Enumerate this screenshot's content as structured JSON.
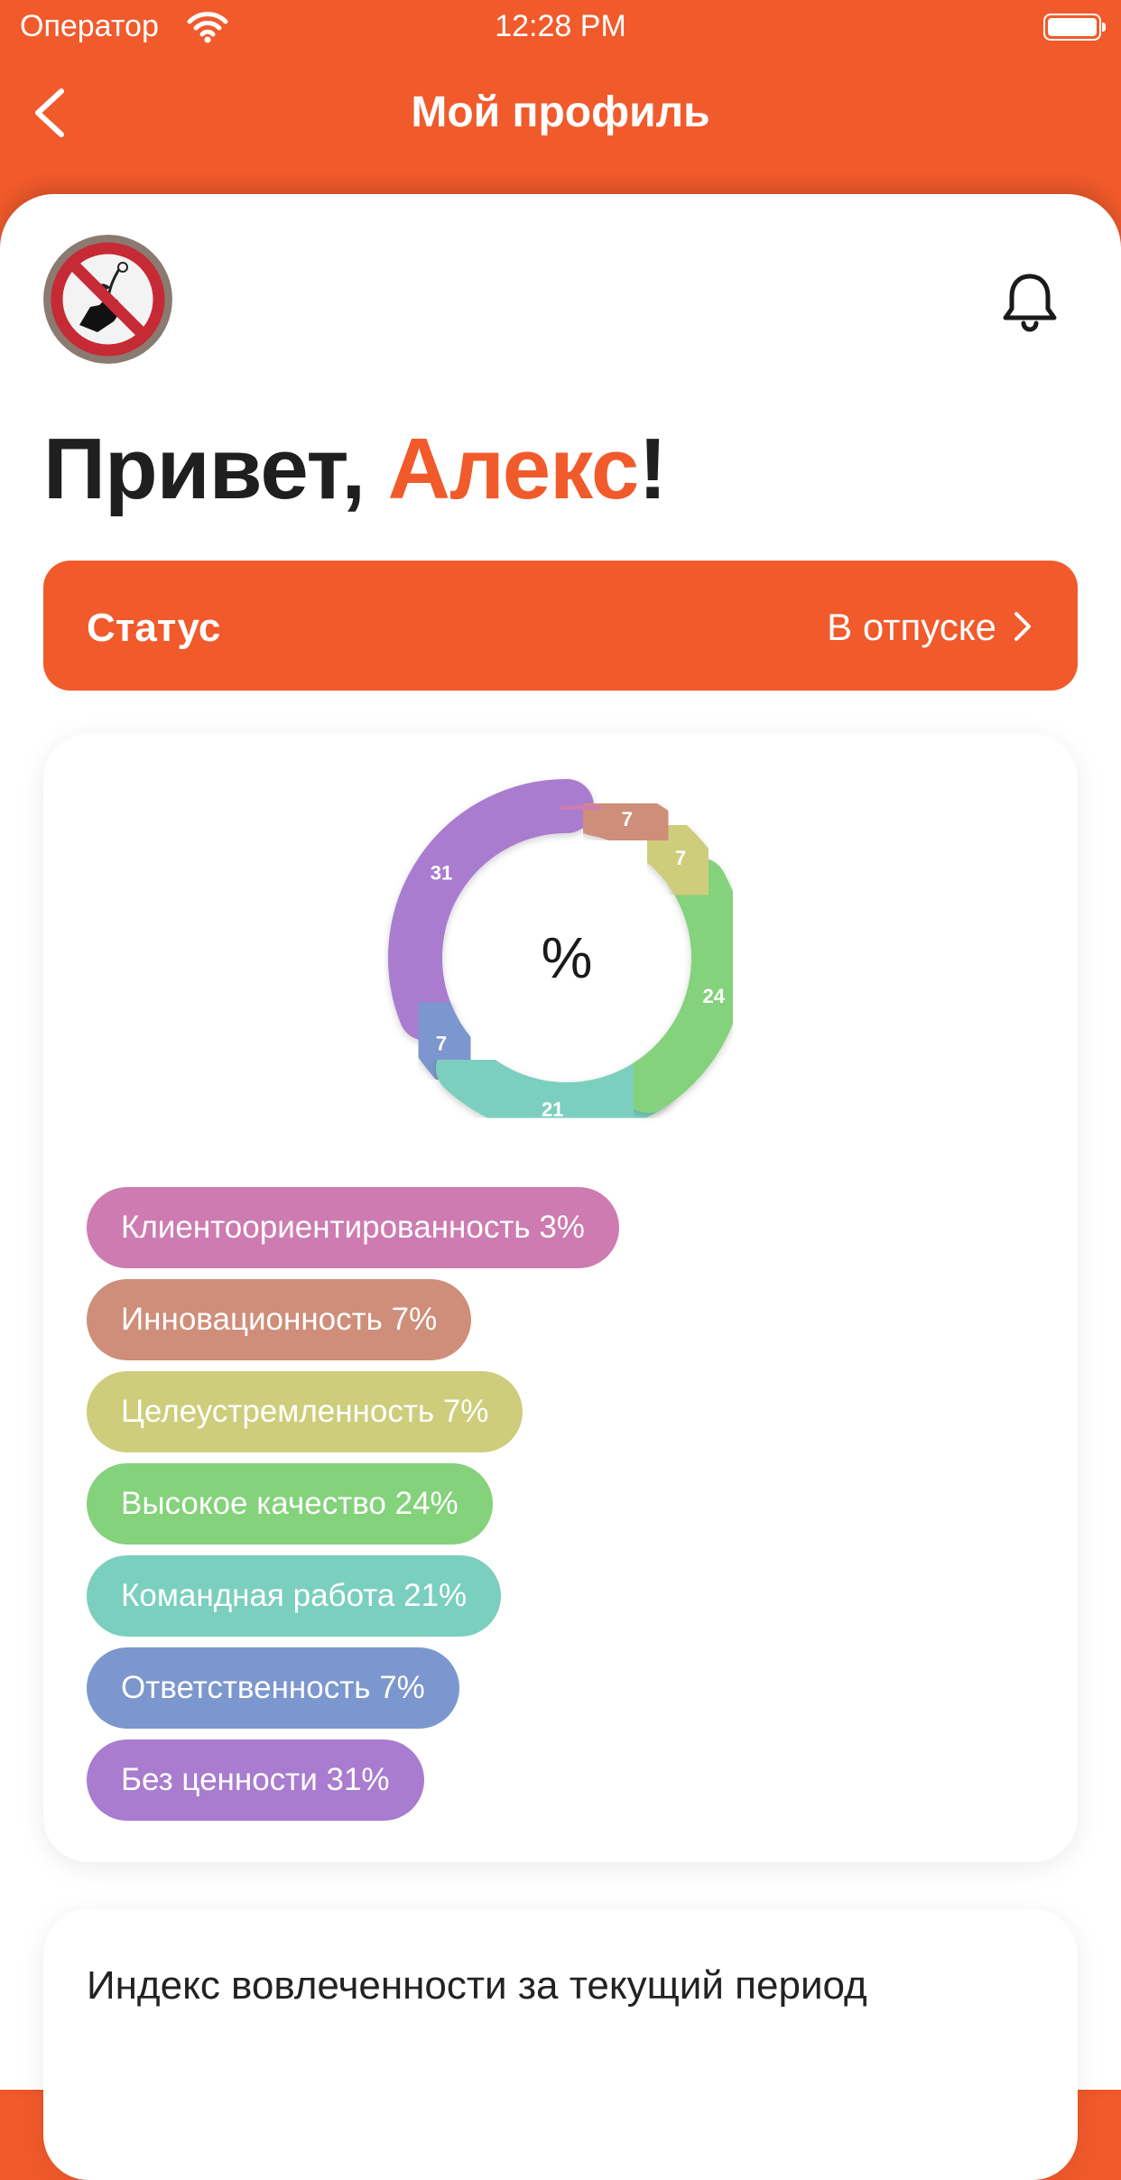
{
  "status_bar": {
    "carrier": "Оператор",
    "time": "12:28 PM"
  },
  "nav": {
    "title": "Мой профиль",
    "back_icon": "chevron-left-icon"
  },
  "header": {
    "avatar_icon": "no-picking-flowers-sign",
    "bell_icon": "bell-icon"
  },
  "greeting": {
    "prefix": "Привет, ",
    "name": "Алекс",
    "suffix": "!"
  },
  "status": {
    "label": "Статус",
    "value": "В отпуске"
  },
  "values_chart": {
    "center_label": "%",
    "legend": [
      {
        "label": "Клиентоориентированность 3%",
        "color": "#cd7bb0"
      },
      {
        "label": "Инновационность 7%",
        "color": "#cf8e79"
      },
      {
        "label": "Целеустремленность 7%",
        "color": "#cdcd7c"
      },
      {
        "label": "Высокое качество 24%",
        "color": "#84d27b"
      },
      {
        "label": "Командная работа 21%",
        "color": "#7bcfbf"
      },
      {
        "label": "Ответственность 7%",
        "color": "#7b97cd"
      },
      {
        "label": "Без ценности 31%",
        "color": "#a97ccf"
      }
    ]
  },
  "chart_data": {
    "type": "pie",
    "donut": true,
    "categories": [
      "Клиентоориентированность",
      "Инновационность",
      "Целеустремленность",
      "Высокое качество",
      "Командная работа",
      "Ответственность",
      "Без ценности"
    ],
    "values": [
      3,
      7,
      7,
      24,
      21,
      7,
      31
    ],
    "labels": [
      "",
      "7",
      "7",
      "24",
      "21",
      "7",
      "31"
    ],
    "colors": [
      "#cd7bb0",
      "#cf8e79",
      "#cdcd7c",
      "#84d27b",
      "#7bcfbf",
      "#7b97cd",
      "#a97ccf"
    ]
  },
  "engagement": {
    "title": "Индекс вовлеченности за текущий период"
  }
}
